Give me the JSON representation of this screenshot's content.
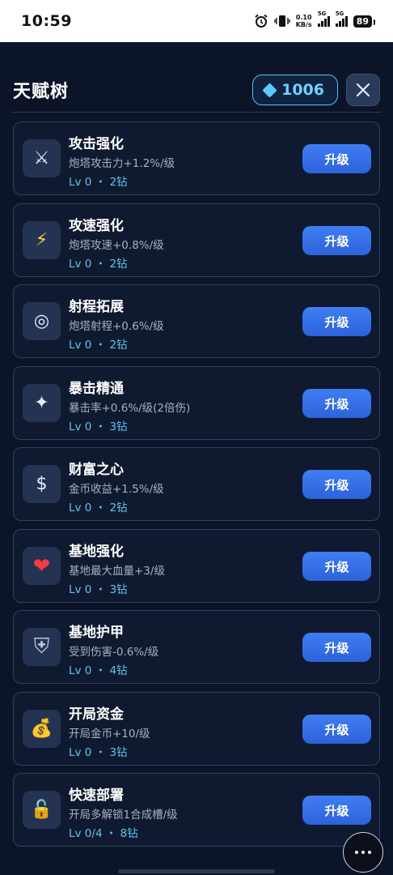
{
  "status": {
    "time": "10:59",
    "net_speed_value": "0.10",
    "net_speed_unit": "KB/s",
    "signal1": "5G",
    "signal2": "5G",
    "battery": "89"
  },
  "header": {
    "title": "天赋树",
    "gems": "1006"
  },
  "talents": [
    {
      "name": "攻击强化",
      "desc": "炮塔攻击力+1.2%/级",
      "level": "Lv 0 ・ 2钻",
      "icon": "⚔",
      "icon_name": "swords-icon"
    },
    {
      "name": "攻速强化",
      "desc": "炮塔攻速+0.8%/级",
      "level": "Lv 0 ・ 2钻",
      "icon": "⚡",
      "icon_name": "lightning-icon"
    },
    {
      "name": "射程拓展",
      "desc": "炮塔射程+0.6%/级",
      "level": "Lv 0 ・ 2钻",
      "icon": "◎",
      "icon_name": "target-icon"
    },
    {
      "name": "暴击精通",
      "desc": "暴击率+0.6%/级(2倍伤)",
      "level": "Lv 0 ・ 3钻",
      "icon": "✦",
      "icon_name": "sparkle-icon"
    },
    {
      "name": "财富之心",
      "desc": "金币收益+1.5%/级",
      "level": "Lv 0 ・ 2钻",
      "icon": "$",
      "icon_name": "dollar-icon"
    },
    {
      "name": "基地强化",
      "desc": "基地最大血量+3/级",
      "level": "Lv 0 ・ 3钻",
      "icon": "❤",
      "icon_name": "heart-icon"
    },
    {
      "name": "基地护甲",
      "desc": "受到伤害-0.6%/级",
      "level": "Lv 0 ・ 4钻",
      "icon": "⛨",
      "icon_name": "shield-icon"
    },
    {
      "name": "开局资金",
      "desc": "开局金币+10/级",
      "level": "Lv 0 ・ 3钻",
      "icon": "💰",
      "icon_name": "money-bag-icon"
    },
    {
      "name": "快速部署",
      "desc": "开局多解锁1合成槽/级",
      "level": "Lv 0/4 ・ 8钻",
      "icon": "🔓",
      "icon_name": "unlock-icon"
    }
  ],
  "upgrade_label": "升级",
  "colors": {
    "background": "#0c1528",
    "accent": "#3f7ef2",
    "gem": "#5cc8ff",
    "level_text": "#62c2ee"
  }
}
